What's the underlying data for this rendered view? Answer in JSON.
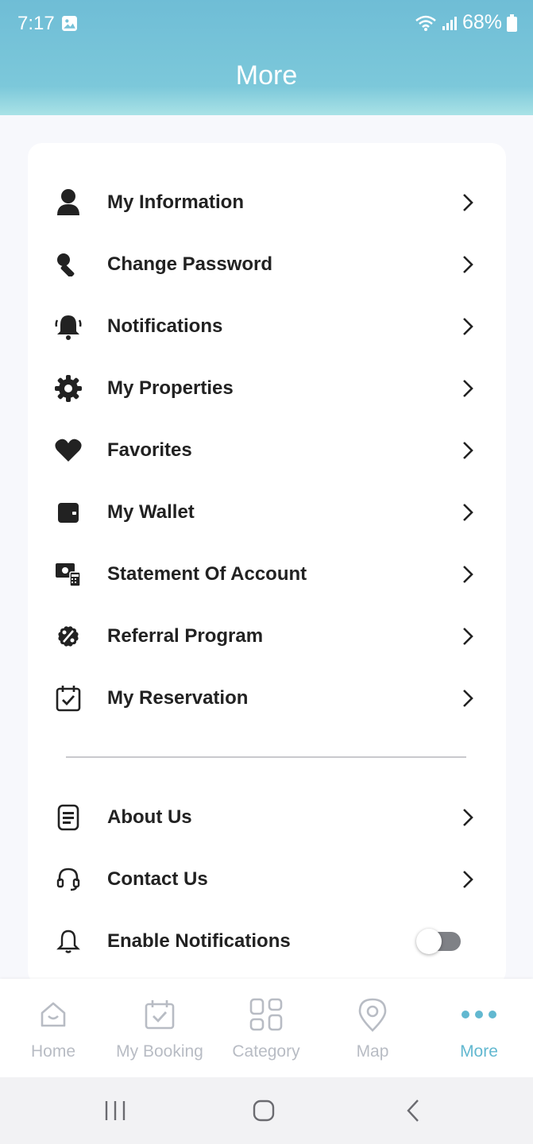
{
  "status_bar": {
    "time": "7:17",
    "battery": "68%",
    "icons": [
      "image-icon",
      "wifi-icon",
      "signal-icon",
      "battery-icon"
    ]
  },
  "header": {
    "title": "More"
  },
  "menu": {
    "primary": [
      {
        "label": "My Information",
        "icon": "user-icon"
      },
      {
        "label": "Change Password",
        "icon": "key-icon"
      },
      {
        "label": "Notifications",
        "icon": "bell-ringing-icon"
      },
      {
        "label": "My Properties",
        "icon": "gear-icon"
      },
      {
        "label": "Favorites",
        "icon": "heart-icon"
      },
      {
        "label": "My Wallet",
        "icon": "wallet-icon"
      },
      {
        "label": "Statement Of Account",
        "icon": "money-calculator-icon"
      },
      {
        "label": "Referral Program",
        "icon": "percent-badge-icon"
      },
      {
        "label": "My Reservation",
        "icon": "calendar-check-icon"
      }
    ],
    "secondary": [
      {
        "label": "About Us",
        "icon": "document-icon"
      },
      {
        "label": "Contact Us",
        "icon": "headset-icon"
      },
      {
        "label": "Enable Notifications",
        "icon": "bell-outline-icon",
        "toggle_on": false
      }
    ]
  },
  "bottom_nav": {
    "items": [
      {
        "label": "Home",
        "icon": "home-icon",
        "active": false
      },
      {
        "label": "My Booking",
        "icon": "calendar-check-icon",
        "active": false
      },
      {
        "label": "Category",
        "icon": "grid-icon",
        "active": false
      },
      {
        "label": "Map",
        "icon": "map-pin-icon",
        "active": false
      },
      {
        "label": "More",
        "icon": "more-dots-icon",
        "active": true
      }
    ]
  },
  "colors": {
    "header_gradient_top": "#6fbdd6",
    "header_gradient_bottom": "#a9e2e6",
    "accent": "#62b8d0",
    "inactive_nav": "#b8bcc4",
    "icon_dark": "#222222"
  }
}
